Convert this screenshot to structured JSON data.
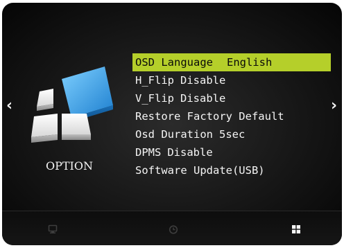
{
  "nav": {
    "left_arrow": "‹",
    "right_arrow": "›"
  },
  "section": {
    "label": "OPTION",
    "icon": "option-blocks-icon"
  },
  "menu": {
    "items": [
      {
        "label": "OSD Language",
        "value": "English",
        "selected": true
      },
      {
        "label": "H_Flip",
        "value": "Disable",
        "selected": false
      },
      {
        "label": "V_Flip",
        "value": "Disable",
        "selected": false
      },
      {
        "label": "Restore Factory Default",
        "value": "",
        "selected": false
      },
      {
        "label": "Osd Duration",
        "value": "5sec",
        "selected": false
      },
      {
        "label": "DPMS",
        "value": "Disable",
        "selected": false
      },
      {
        "label": "Software Update(USB)",
        "value": "",
        "selected": false
      }
    ]
  },
  "bottom_tabs": [
    {
      "icon": "monitor-icon",
      "active": false
    },
    {
      "icon": "clock-icon",
      "active": false
    },
    {
      "icon": "grid-icon",
      "active": true
    }
  ],
  "colors": {
    "highlight": "#b5cf2a",
    "text": "#f5f5f5",
    "background": "#161616",
    "accent_blue": "#2f9be0"
  }
}
